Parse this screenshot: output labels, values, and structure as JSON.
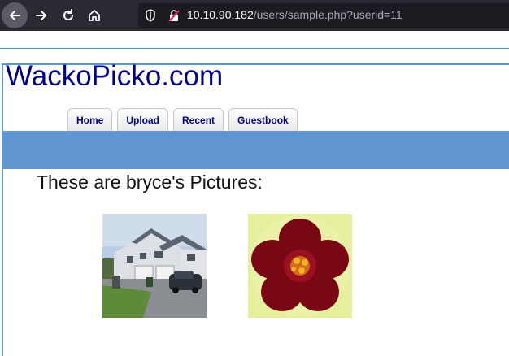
{
  "browser": {
    "url_host": "10.10.90.182",
    "url_path": "/users/sample.php?userid=11",
    "icons": [
      "back-arrow-icon",
      "forward-arrow-icon",
      "reload-icon",
      "home-icon",
      "shield-icon",
      "insecure-lock-icon"
    ]
  },
  "site": {
    "logo": "WackoPicko.com",
    "nav_tabs": [
      {
        "label": "Home"
      },
      {
        "label": "Upload"
      },
      {
        "label": "Recent"
      },
      {
        "label": "Guestbook"
      }
    ],
    "accent_color": "#5f96cf",
    "logo_color": "#00008b"
  },
  "main": {
    "heading": "These are bryce's Pictures:",
    "pictures": [
      {
        "subject": "house"
      },
      {
        "subject": "flower"
      }
    ]
  }
}
